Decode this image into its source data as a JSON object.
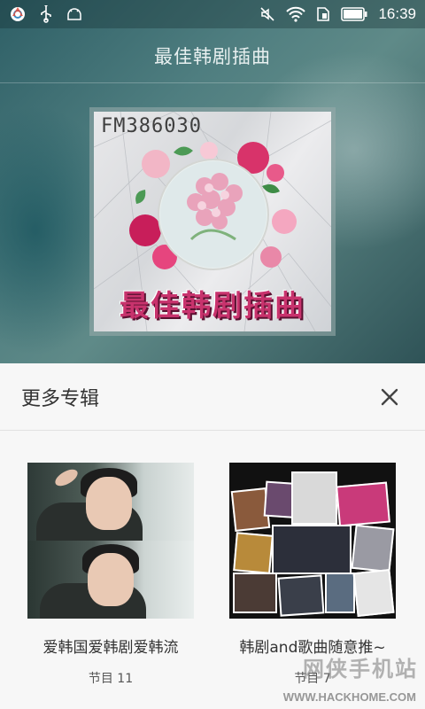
{
  "status_bar": {
    "time": "16:39",
    "left_icons": [
      "browser-icon",
      "usb-icon",
      "android-debug-icon"
    ],
    "right_icons": [
      "mute-icon",
      "wifi-icon",
      "sim-icon",
      "battery-icon"
    ]
  },
  "header": {
    "title": "最佳韩剧插曲"
  },
  "cover": {
    "fm_label": "FM386030",
    "caption": "最佳韩剧插曲"
  },
  "more_albums": {
    "title": "更多专辑",
    "close_icon": "close-icon",
    "items": [
      {
        "name": "爱韩国爱韩剧爱韩流",
        "count": "节目 11"
      },
      {
        "name": "韩剧and歌曲随意推~",
        "count": "节目 7"
      }
    ]
  },
  "watermark": {
    "text": "网侠手机站",
    "url": "WWW.HACKHOME.COM"
  },
  "colors": {
    "accent_pink": "#c8336d",
    "sheet_bg": "#f7f7f7",
    "title_text": "#e8f0f0"
  }
}
